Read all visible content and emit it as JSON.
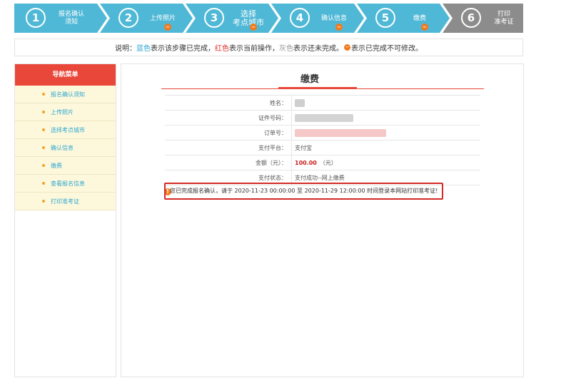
{
  "steps": [
    {
      "num": "1",
      "line1": "报名确认",
      "line2": "须知",
      "color": "#4fb8d6",
      "locked": false
    },
    {
      "num": "2",
      "line1": "上传照片",
      "line2": "",
      "color": "#4fb8d6",
      "locked": true
    },
    {
      "num": "3",
      "line1": "选择",
      "line2": "考点城市",
      "color": "#4fb8d6",
      "locked": true,
      "big": true
    },
    {
      "num": "4",
      "line1": "确认信息",
      "line2": "",
      "color": "#4fb8d6",
      "locked": true
    },
    {
      "num": "5",
      "line1": "缴费",
      "line2": "",
      "color": "#4fb8d6",
      "locked": true
    },
    {
      "num": "6",
      "line1": "打印",
      "line2": "准考证",
      "color": "#8c8c8c",
      "locked": false
    }
  ],
  "explain": {
    "prefix": "说明：",
    "blue": "蓝色",
    "blue_text": "表示该步骤已完成，",
    "red": "红色",
    "red_text": "表示当前操作，",
    "gray": "灰色",
    "gray_text": "表示还未完成。",
    "lock_text": "表示已完成不可修改。"
  },
  "sidebar": {
    "title": "导航菜单",
    "items": [
      "报名确认须知",
      "上传照片",
      "选择考点城市",
      "确认信息",
      "缴费",
      "查看报名信息",
      "打印准考证"
    ]
  },
  "main": {
    "title": "缴费",
    "rows": [
      {
        "label": "姓名：",
        "value": ""
      },
      {
        "label": "证件号码：",
        "value": ""
      },
      {
        "label": "订单号：",
        "value": ""
      },
      {
        "label": "支付平台：",
        "value": "支付宝"
      },
      {
        "label": "金额（元）：",
        "value": "100.00",
        "unit": "（元）"
      },
      {
        "label": "支付状态：",
        "value": "支付成功--网上缴费"
      }
    ],
    "notice": "您已完成报名确认，请于 2020-11-23 00:00:00 至 2020-11-29 12:00:00 时间登录本网站打印准考证!"
  },
  "colors": {
    "step_done": "#4fb8d6",
    "step_pending": "#8c8c8c",
    "accent_red": "#e9473a",
    "lock_orange": "#f07a1e"
  }
}
